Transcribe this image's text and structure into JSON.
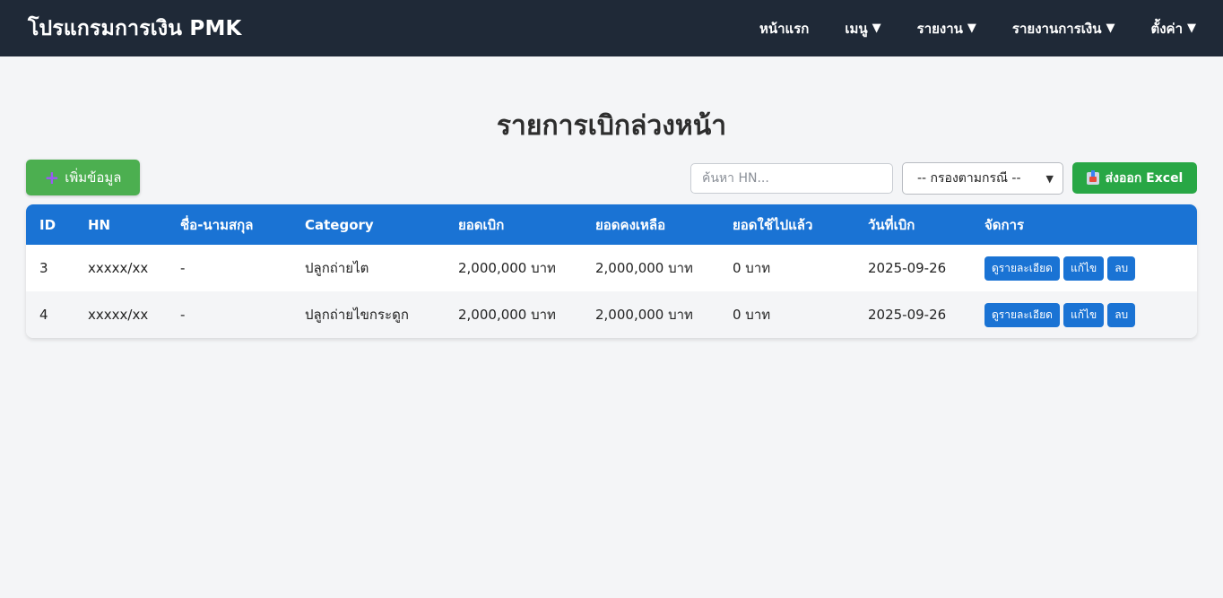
{
  "navbar": {
    "brand": "โปรแกรมการเงิน PMK",
    "items": [
      {
        "label": "หน้าแรก",
        "caret": ""
      },
      {
        "label": "เมนู",
        "caret": "▼"
      },
      {
        "label": "รายงาน",
        "caret": "▼"
      },
      {
        "label": "รายงานการเงิน",
        "caret": "▼"
      },
      {
        "label": "ตั้งค่า",
        "caret": "▼"
      }
    ]
  },
  "page": {
    "title": "รายการเบิกล่วงหน้า"
  },
  "toolbar": {
    "add_icon": "+",
    "add_label": "เพิ่มข้อมูล",
    "search_placeholder": "ค้นหา HN...",
    "search_value": "",
    "filter_selected": "-- กรองตามกรณี --",
    "excel_label": "ส่งออก Excel",
    "excel_icon_name": "inbox-tray-icon"
  },
  "table": {
    "headers": {
      "id": "ID",
      "hn": "HN",
      "name": "ชื่อ-นามสกุล",
      "category": "Category",
      "amount": "ยอดเบิก",
      "remaining": "ยอดคงเหลือ",
      "used": "ยอดใช้ไปแล้ว",
      "date": "วันที่เบิก",
      "actions": "จัดการ"
    },
    "rows": [
      {
        "id": "3",
        "hn": "xxxxx/xx",
        "name": "-",
        "category": "ปลูกถ่ายไต",
        "amount": "2,000,000 บาท",
        "remaining": "2,000,000 บาท",
        "used": "0 บาท",
        "date": "2025-09-26",
        "view": "ดูรายละเอียด",
        "edit": "แก้ไข",
        "delete": "ลบ"
      },
      {
        "id": "4",
        "hn": "xxxxx/xx",
        "name": "-",
        "category": "ปลูกถ่ายไขกระดูก",
        "amount": "2,000,000 บาท",
        "remaining": "2,000,000 บาท",
        "used": "0 บาท",
        "date": "2025-09-26",
        "view": "ดูรายละเอียด",
        "edit": "แก้ไข",
        "delete": "ลบ"
      }
    ]
  },
  "colors": {
    "navbar": "#1f2937",
    "primary": "#1a73d4",
    "add_button": "#4caf50",
    "excel_button": "#28a745",
    "background": "#f4f5f7"
  }
}
